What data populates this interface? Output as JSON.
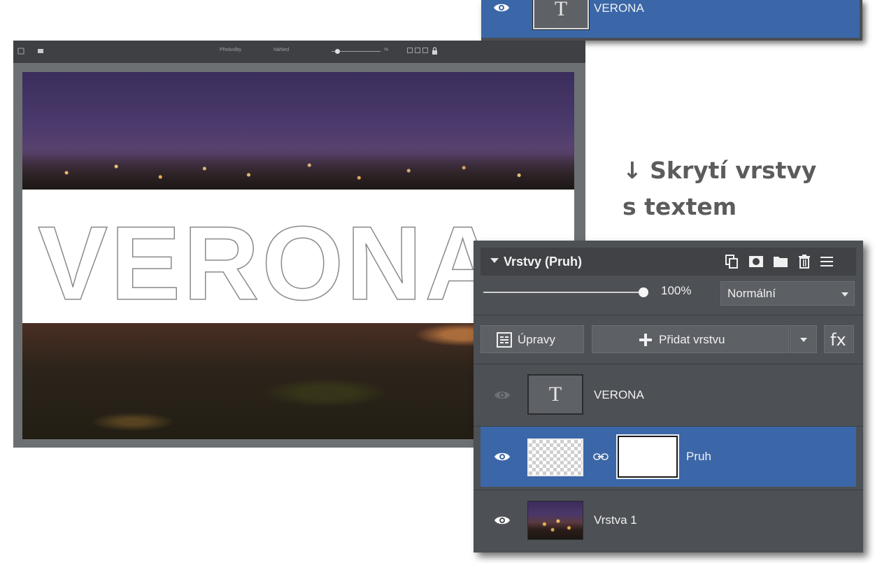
{
  "top_snippet": {
    "layer_name": "VERONA",
    "thumb_glyph": "T"
  },
  "editor": {
    "toolbar_items": [
      "Předvolby",
      "Náhled",
      "",
      "%"
    ],
    "canvas_text": "VERONA"
  },
  "annotation": {
    "line1": "↓ Skrytí vrstvy",
    "line2": "s textem"
  },
  "layers_panel": {
    "title": "Vrstvy (Pruh)",
    "header_icons": [
      "duplicate-icon",
      "mask-icon",
      "folder-icon",
      "trash-icon",
      "menu-icon"
    ],
    "opacity": "100%",
    "opacity_fraction": 1.0,
    "blend_mode": "Normální",
    "adjust_button": "Úpravy",
    "add_layer_button": "Přidat vrstvu",
    "fx_button": "fx",
    "layers": [
      {
        "name": "VERONA",
        "type": "text",
        "thumb_glyph": "T",
        "visible": false,
        "selected": false
      },
      {
        "name": "Pruh",
        "type": "masked",
        "visible": true,
        "selected": true
      },
      {
        "name": "Vrstva 1",
        "type": "photo",
        "visible": true,
        "selected": false
      }
    ]
  },
  "colors": {
    "selection_blue": "#3b67a8",
    "panel_bg": "#4d5054",
    "annotation_gray": "#5c5c5c"
  }
}
